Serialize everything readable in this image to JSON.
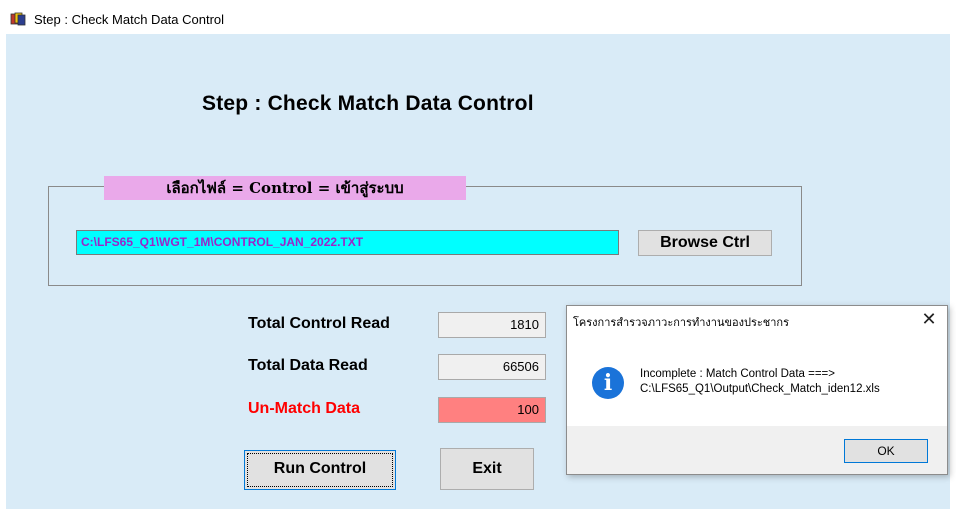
{
  "window": {
    "title": "Step : Check Match Data Control",
    "icon": "app-cards-icon"
  },
  "heading": "Step : Check Match Data Control",
  "file_group": {
    "legend": "เลือกไฟล์ = Control = เข้าสู่ระบบ",
    "path_value": "C:\\LFS65_Q1\\WGT_1M\\CONTROL_JAN_2022.TXT",
    "browse_label": "Browse Ctrl"
  },
  "stats": {
    "total_control_label": "Total Control Read",
    "total_control_value": "1810",
    "total_data_label": "Total Data Read",
    "total_data_value": "66506",
    "unmatch_label": "Un-Match Data",
    "unmatch_value": "100"
  },
  "buttons": {
    "run": "Run Control",
    "exit": "Exit"
  },
  "dialog": {
    "title": "โครงการสำรวจภาวะการทำงานของประชากร",
    "close": "✕",
    "icon": "info-icon",
    "message_line1": "Incomplete : Match Control Data ===>",
    "message_line2": "C:\\LFS65_Q1\\Output\\Check_Match_iden12.xls",
    "ok": "OK"
  },
  "colors": {
    "window_bg": "#d9ebf7",
    "legend_bg": "#eaa9ea",
    "path_bg": "#00ffff",
    "path_text": "#9b27c9",
    "unmatch_bg": "#ff8080",
    "unmatch_text": "#ff0000",
    "info_blue": "#1a73d9"
  }
}
